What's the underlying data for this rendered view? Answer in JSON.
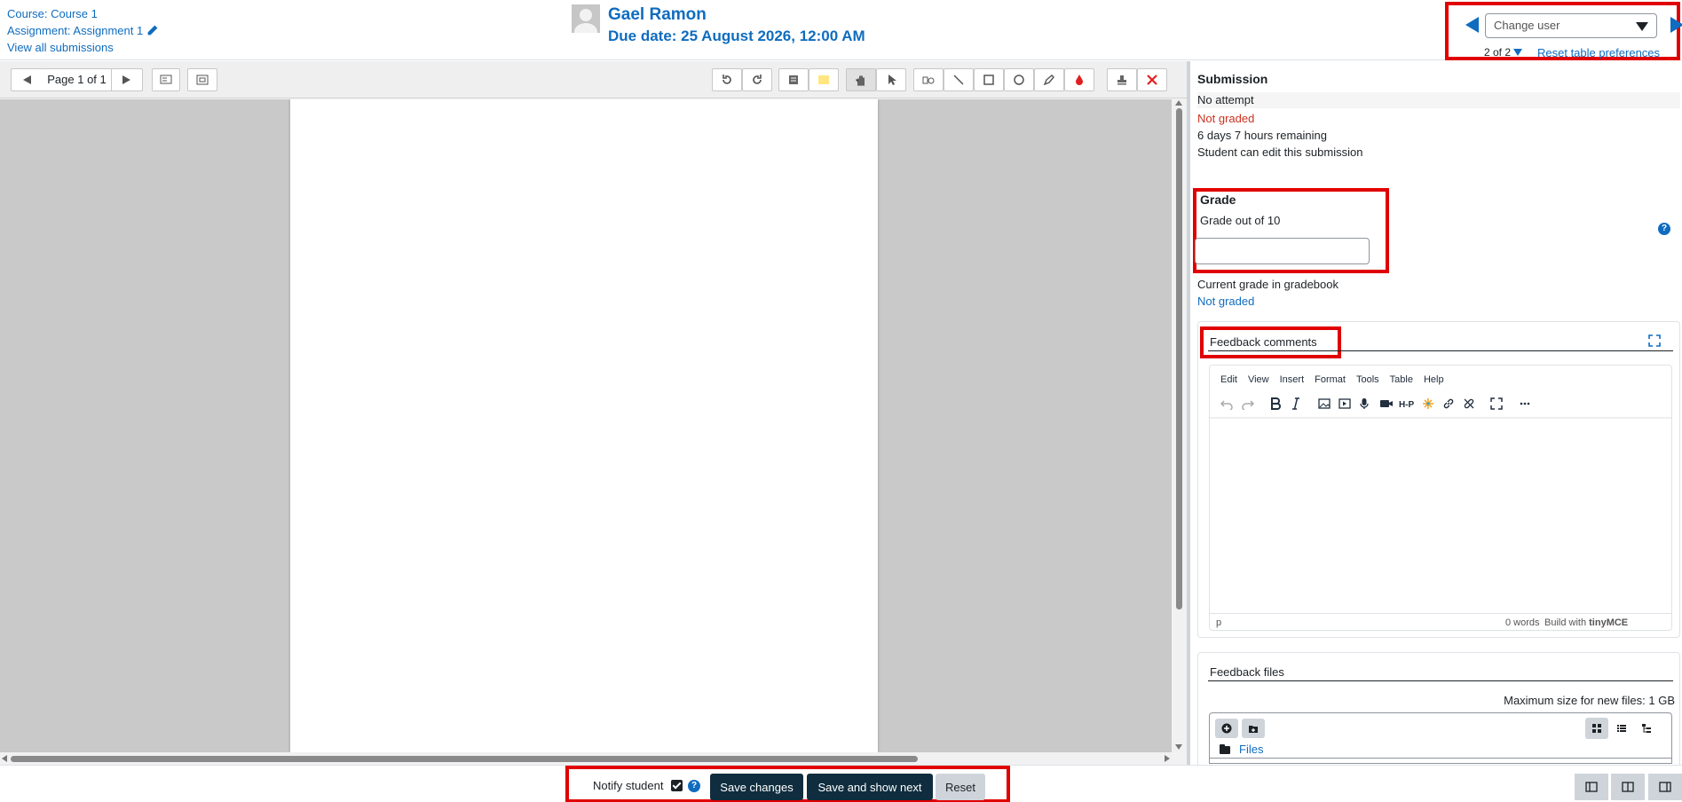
{
  "header": {
    "course_link": "Course: Course 1",
    "assignment_link": "Assignment: Assignment 1",
    "view_all_link": "View all submissions",
    "user_name": "Gael Ramon",
    "due_date": "Due date: 25 August 2026, 12:00 AM",
    "change_user_placeholder": "Change user",
    "user_count": "2 of 2",
    "reset_prefs_link": "Reset table preferences"
  },
  "pdf_toolbar": {
    "page_label": "Page 1 of 1"
  },
  "submission": {
    "heading": "Submission",
    "attempt_status": "No attempt",
    "grading_status": "Not graded",
    "time_remaining": "6 days 7 hours remaining",
    "edit_status": "Student can edit this submission"
  },
  "grade": {
    "heading": "Grade",
    "label": "Grade out of 10",
    "value": "",
    "current_label": "Current grade in gradebook",
    "current_value": "Not graded",
    "help_glyph": "?"
  },
  "feedback_comments": {
    "title": "Feedback comments",
    "menu": [
      "Edit",
      "View",
      "Insert",
      "Format",
      "Tools",
      "Table",
      "Help"
    ],
    "path": "p",
    "words": "0 words",
    "brand_prefix": "Build with",
    "brand_name": "tinyMCE"
  },
  "feedback_files": {
    "title": "Feedback files",
    "max_size": "Maximum size for new files: 1 GB",
    "folder_label": "Files"
  },
  "bottom_bar": {
    "notify_label": "Notify student",
    "notify_checked": true,
    "save_label": "Save changes",
    "save_next_label": "Save and show next",
    "reset_label": "Reset"
  },
  "colors": {
    "link": "#0f6cbf",
    "not_graded": "#ca3120",
    "highlight_border": "#e00000",
    "primary_button": "#0f2d3e"
  }
}
